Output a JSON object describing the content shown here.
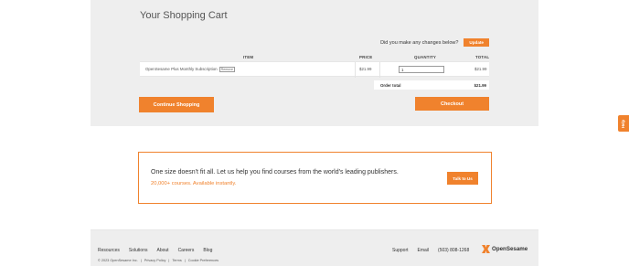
{
  "cart": {
    "title": "Your Shopping Cart",
    "changes_prompt": "Did you make any changes below?",
    "update_label": "Update",
    "columns": {
      "item": "ITEM",
      "price": "PRICE",
      "quantity": "QUANTITY",
      "total": "TOTAL"
    },
    "items": [
      {
        "name": "OpenSesame Plus Monthly Subscription",
        "badge": "Remove",
        "price": "$21.99",
        "quantity": "1",
        "total": "$21.99"
      }
    ],
    "order_total_label": "Order total",
    "order_total_value": "$21.99",
    "continue_label": "Continue Shopping",
    "checkout_label": "Checkout"
  },
  "help": {
    "label": "Help"
  },
  "promo": {
    "headline": "One size doesn't fit all. Let us help you find courses from the world's leading publishers.",
    "sub": "20,000+ courses. Available instantly.",
    "cta": "Talk to Us"
  },
  "footer": {
    "nav": [
      "Resources",
      "Solutions",
      "About",
      "Careers",
      "Blog"
    ],
    "right": [
      "Support",
      "Email",
      "(503) 808-1268"
    ],
    "logo_text": "OpenSesame",
    "legal": [
      "© 2023 OpenSesame Inc.",
      "|",
      "Privacy Policy",
      "|",
      "Terms",
      "|",
      "Cookie Preferences"
    ]
  },
  "colors": {
    "accent": "#f0822d",
    "panel": "#eeeeee"
  }
}
